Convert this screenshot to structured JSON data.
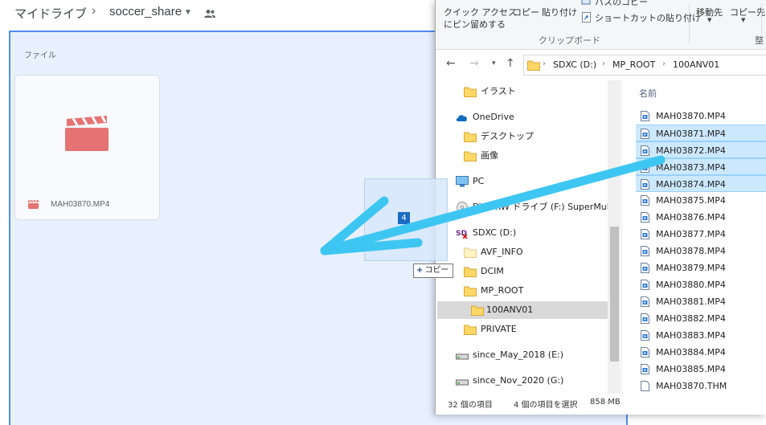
{
  "drive": {
    "breadcrumb_root": "マイドライブ",
    "breadcrumb_separator": "›",
    "breadcrumb_folder": "soccer_share",
    "files_heading": "ファイル",
    "file_name": "MAH03870.MP4"
  },
  "drag": {
    "count_badge": "4",
    "copy_tip_plus": "+",
    "copy_tip_label": "コピー"
  },
  "ribbon": {
    "pin_line1": "クイック アクセス",
    "pin_line2": "にピン留めする",
    "copy": "コピー",
    "paste": "貼り付け",
    "copy_path": "パスのコピー",
    "paste_shortcut": "ショートカットの貼り付け",
    "move_to": "移動先",
    "copy_to": "コピー先",
    "group_clipboard": "クリップボード",
    "group_organize": "整"
  },
  "address": {
    "crumbs": [
      "SDXC (D:)",
      "MP_ROOT",
      "100ANV01"
    ]
  },
  "nav_tree": [
    {
      "label": "イラスト",
      "icon": "folder-icon"
    },
    {
      "label": "OneDrive",
      "icon": "cloud-icon"
    },
    {
      "label": "デスクトップ",
      "icon": "folder-icon"
    },
    {
      "label": "画像",
      "icon": "folder-icon"
    },
    {
      "label": "PC",
      "icon": "computer-icon"
    },
    {
      "label": "DVD RW ドライブ (F:) SuperMulti",
      "icon": "dvd-icon"
    },
    {
      "label": "SDXC (D:)",
      "icon": "sd-card-icon"
    },
    {
      "label": "AVF_INFO",
      "icon": "folder-icon"
    },
    {
      "label": "DCIM",
      "icon": "folder-icon"
    },
    {
      "label": "MP_ROOT",
      "icon": "folder-icon"
    },
    {
      "label": "100ANV01",
      "icon": "folder-icon"
    },
    {
      "label": "PRIVATE",
      "icon": "folder-icon"
    },
    {
      "label": "since_May_2018 (E:)",
      "icon": "drive-icon"
    },
    {
      "label": "since_Nov_2020 (G:)",
      "icon": "drive-icon"
    }
  ],
  "file_list": {
    "column_name": "名前",
    "files": [
      "MAH03870.MP4",
      "MAH03871.MP4",
      "MAH03872.MP4",
      "MAH03873.MP4",
      "MAH03874.MP4",
      "MAH03875.MP4",
      "MAH03876.MP4",
      "MAH03877.MP4",
      "MAH03878.MP4",
      "MAH03879.MP4",
      "MAH03880.MP4",
      "MAH03881.MP4",
      "MAH03882.MP4",
      "MAH03883.MP4",
      "MAH03884.MP4",
      "MAH03885.MP4",
      "MAH03870.THM"
    ]
  },
  "status": {
    "count": "32 個の項目",
    "selected": "4 個の項目を選択",
    "size": "858 MB"
  },
  "colors": {
    "drop_zone_bg": "#e8f0fe",
    "drop_zone_border": "#4f8ef7",
    "video_icon": "#e57373",
    "arrow": "#3ec6f2",
    "selection": "#cce8ff",
    "folder": "#ffd766"
  }
}
